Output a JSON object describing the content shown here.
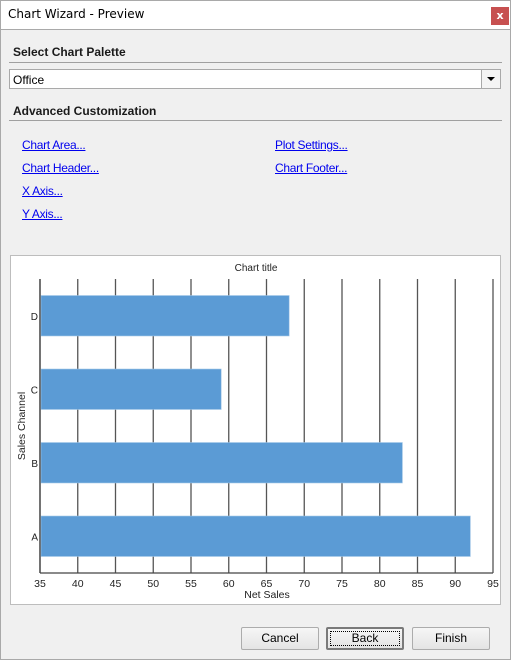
{
  "window": {
    "title": "Chart Wizard - Preview",
    "close_label": "x",
    "close_color": "#c75050"
  },
  "palette": {
    "section_label": "Select Chart Palette",
    "selected_value": "Office"
  },
  "advanced": {
    "section_label": "Advanced Customization",
    "links_left": [
      "Chart Area...",
      "Chart Header...",
      "X Axis...",
      "Y Axis..."
    ],
    "links_right": [
      "Plot Settings...",
      "Chart Footer..."
    ],
    "link_color": "#0000ee"
  },
  "buttons": {
    "cancel": "Cancel",
    "back": "Back",
    "finish": "Finish"
  },
  "chart_data": {
    "type": "bar",
    "orientation": "horizontal",
    "title": "Chart title",
    "xlabel": "Net Sales",
    "ylabel": "Sales Channel",
    "categories": [
      "A",
      "B",
      "C",
      "D"
    ],
    "values": [
      92,
      83,
      59,
      68
    ],
    "xlim": [
      35,
      95
    ],
    "xticks": [
      35,
      40,
      45,
      50,
      55,
      60,
      65,
      70,
      75,
      80,
      85,
      90,
      95
    ],
    "grid": "vertical",
    "bar_color": "#5b9bd5",
    "legend": "none"
  }
}
